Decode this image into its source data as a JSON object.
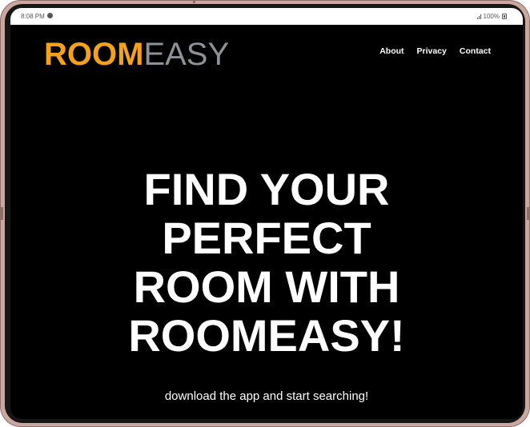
{
  "status_bar": {
    "time": "8:08 PM",
    "battery": "100%"
  },
  "header": {
    "logo_part1": "ROOM",
    "logo_part2": "EASY",
    "nav": [
      "About",
      "Privacy",
      "Contact"
    ]
  },
  "hero": {
    "headline_lines": [
      "FIND YOUR",
      "PERFECT",
      "ROOM WITH",
      "ROOMEASY!"
    ],
    "subtitle": "download the app and start searching!"
  },
  "colors": {
    "logo_accent": "#f5a21b",
    "logo_secondary": "#8d9296",
    "background": "#000000",
    "device_frame": "#caa79f"
  }
}
